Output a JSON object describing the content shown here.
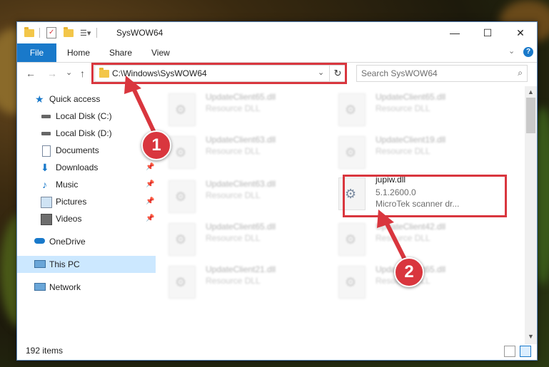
{
  "window": {
    "title": "SysWOW64",
    "minimize_glyph": "—",
    "maximize_glyph": "☐",
    "close_glyph": "✕"
  },
  "ribbon": {
    "file": "File",
    "home": "Home",
    "share": "Share",
    "view": "View",
    "help_glyph": "?"
  },
  "nav": {
    "back_glyph": "←",
    "forward_glyph": "→",
    "recent_glyph": "⌄",
    "up_glyph": "↑",
    "address": "C:\\Windows\\SysWOW64",
    "address_dropdown_glyph": "⌄",
    "refresh_glyph": "↻",
    "search_placeholder": "Search SysWOW64",
    "search_glyph": "⌕"
  },
  "sidebar": {
    "items": [
      {
        "label": "Quick access",
        "icon": "star-icon",
        "pinned": false
      },
      {
        "label": "Local Disk (C:)",
        "icon": "drive-icon",
        "pinned": false
      },
      {
        "label": "Local Disk (D:)",
        "icon": "drive-icon",
        "pinned": false
      },
      {
        "label": "Documents",
        "icon": "documents-icon",
        "pinned": false
      },
      {
        "label": "Downloads",
        "icon": "download-icon",
        "pinned": true
      },
      {
        "label": "Music",
        "icon": "music-icon",
        "pinned": true
      },
      {
        "label": "Pictures",
        "icon": "pictures-icon",
        "pinned": true
      },
      {
        "label": "Videos",
        "icon": "videos-icon",
        "pinned": true
      },
      {
        "label": "OneDrive",
        "icon": "cloud-icon",
        "pinned": false
      },
      {
        "label": "This PC",
        "icon": "computer-icon",
        "pinned": false,
        "selected": true
      },
      {
        "label": "Network",
        "icon": "network-icon",
        "pinned": false
      }
    ],
    "pin_glyph": "📌"
  },
  "files": [
    {
      "name": "UpdateClient65.dll",
      "desc": "Resource DLL"
    },
    {
      "name": "UpdateClient65.dll",
      "desc": "Resource DLL"
    },
    {
      "name": "UpdateClient63.dll",
      "desc": "Resource DLL"
    },
    {
      "name": "UpdateClient19.dll",
      "desc": "Resource DLL"
    },
    {
      "name": "UpdateClient63.dll",
      "desc": "Resource DLL"
    },
    {
      "name": "jupiw.dll",
      "version": "5.1.2600.0",
      "desc": "MicroTek scanner dr..."
    },
    {
      "name": "UpdateClient65.dll",
      "desc": "Resource DLL"
    },
    {
      "name": "UpdateClient42.dll",
      "desc": "Resource DLL"
    },
    {
      "name": "UpdateClient21.dll",
      "desc": "Resource DLL"
    },
    {
      "name": "UpdateClient65.dll",
      "desc": "Resource DLL"
    }
  ],
  "status": {
    "count": "192 items"
  },
  "callouts": {
    "one": "1",
    "two": "2"
  },
  "colors": {
    "accent": "#1979ca",
    "highlight": "#d9363e",
    "selection": "#cce8ff"
  }
}
